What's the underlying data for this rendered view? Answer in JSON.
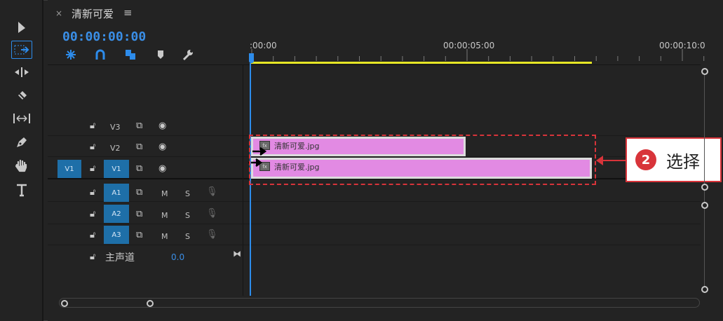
{
  "sequence": {
    "tab_close": "×",
    "tab_title": "清新可爱",
    "tab_menu": "≡",
    "timecode": "00:00:00:00"
  },
  "tools": [
    "selection-tool",
    "track-select-tool",
    "ripple-edit-tool",
    "razor-tool",
    "slip-tool",
    "pen-tool",
    "hand-tool",
    "type-tool"
  ],
  "timeline_icons": [
    "snap-icon",
    "linked-selection-icon",
    "add-marker-icon",
    "marker-icon",
    "settings-wrench-icon"
  ],
  "ruler": {
    "labels": [
      ":00:00",
      "00:00:05:00",
      "00:00:10:0"
    ]
  },
  "video_tracks": [
    {
      "name": "V3",
      "source": ""
    },
    {
      "name": "V2",
      "source": ""
    },
    {
      "name": "V1",
      "source": "V1"
    }
  ],
  "audio_tracks": [
    {
      "name": "A1",
      "m": "M",
      "s": "S"
    },
    {
      "name": "A2",
      "m": "M",
      "s": "S"
    },
    {
      "name": "A3",
      "m": "M",
      "s": "S"
    }
  ],
  "master": {
    "label": "主声道",
    "value": "0.0"
  },
  "clips": [
    {
      "track": "V2",
      "name": "清新可爱.jpg",
      "fx": "fx"
    },
    {
      "track": "V1",
      "name": "清新可爱.jpg",
      "fx": "fx"
    }
  ],
  "callout": {
    "number": "2",
    "text": "选择"
  },
  "colors": {
    "accent": "#2d8ceb",
    "clip": "#e28ae3",
    "workbar": "#e6e625",
    "callout": "#d8343a"
  }
}
